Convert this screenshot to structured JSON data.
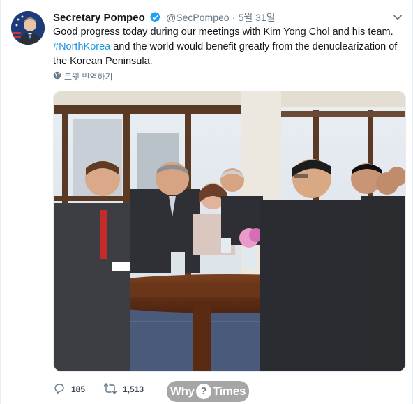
{
  "tweet": {
    "display_name": "Secretary Pompeo",
    "handle": "@SecPompeo",
    "separator": "·",
    "date": "5월 31일",
    "text_before": "Good progress today during our meetings with Kim Yong Chol and his team. ",
    "hashtag": "#NorthKorea",
    "text_after": " and the world would benefit greatly from the denuclearization of the Korean Peninsula.",
    "translate_label": "트윗 번역하기"
  },
  "actions": {
    "replies": "185",
    "retweets": "1,513"
  },
  "watermark": {
    "left": "Why",
    "mark": "?",
    "right": "Times"
  },
  "colors": {
    "link": "#1b95e0",
    "muted": "#657786",
    "verified": "#1da1f2"
  }
}
